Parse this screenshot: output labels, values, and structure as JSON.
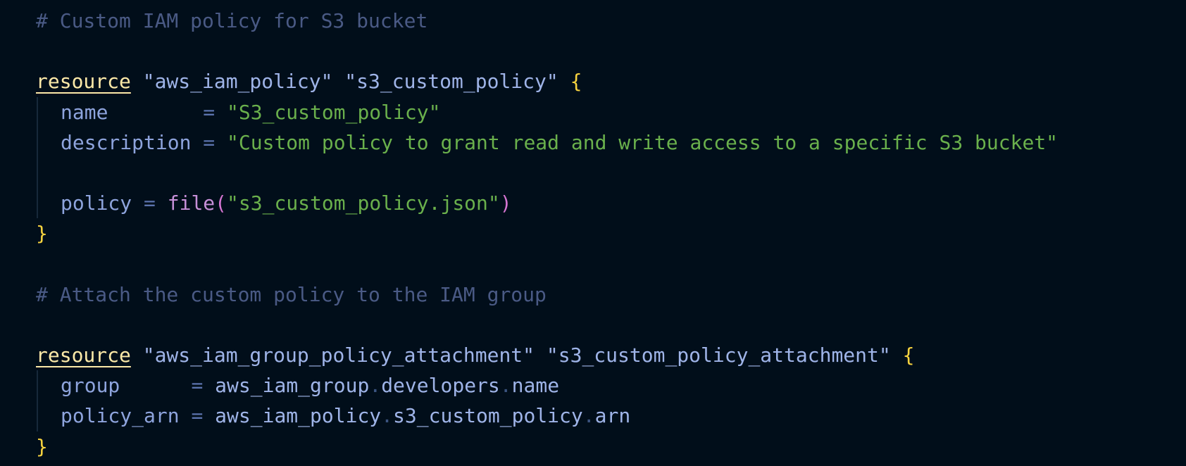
{
  "code": {
    "comment1": "# Custom IAM policy for S3 bucket",
    "block1": {
      "keyword": "resource",
      "type": "\"aws_iam_policy\"",
      "label": "\"s3_custom_policy\"",
      "open_brace": "{",
      "name_key": "name",
      "name_pad": "        ",
      "eq": "=",
      "name_value": "\"S3_custom_policy\"",
      "desc_key": "description",
      "desc_value": "\"Custom policy to grant read and write access to a specific S3 bucket\"",
      "policy_key": "policy",
      "policy_fn": "file",
      "paren_open": "(",
      "policy_arg": "\"s3_custom_policy.json\"",
      "paren_close": ")",
      "close_brace": "}"
    },
    "comment2": "# Attach the custom policy to the IAM group",
    "block2": {
      "keyword": "resource",
      "type": "\"aws_iam_group_policy_attachment\"",
      "label": "\"s3_custom_policy_attachment\"",
      "open_brace": "{",
      "group_key": "group",
      "group_pad": "      ",
      "eq": "=",
      "group_ref1": "aws_iam_group",
      "group_ref2": "developers",
      "group_ref3": "name",
      "arn_key": "policy_arn",
      "arn_ref1": "aws_iam_policy",
      "arn_ref2": "s3_custom_policy",
      "arn_ref3": "arn",
      "dot": ".",
      "close_brace": "}"
    }
  },
  "colors": {
    "background": "#010e1a",
    "comment": "#4a5a85",
    "keyword": "#fde9a8",
    "string": "#6ab04c",
    "brace": "#f7d33f",
    "function": "#c790d8"
  }
}
